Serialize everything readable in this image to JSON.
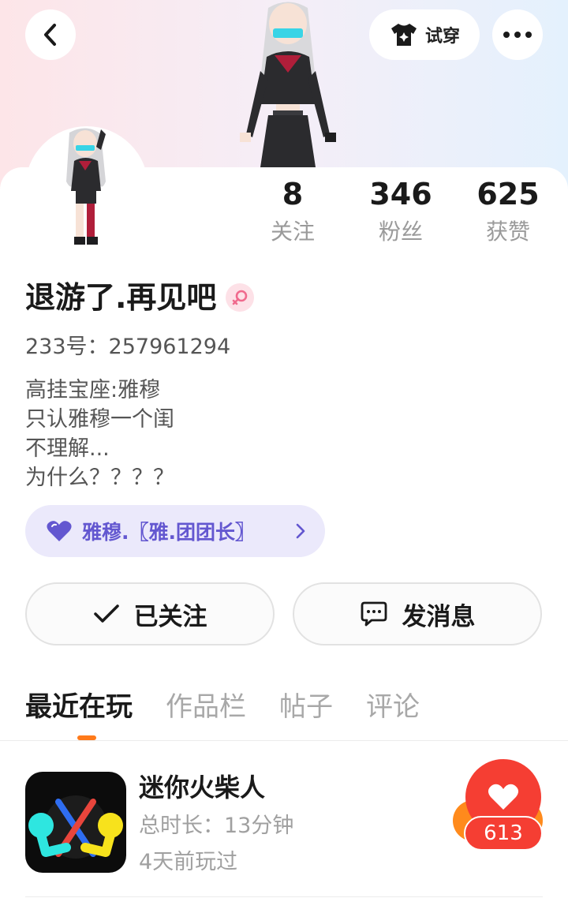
{
  "header": {
    "try_on_label": "试穿"
  },
  "stats": [
    {
      "value": "8",
      "label": "关注"
    },
    {
      "value": "346",
      "label": "粉丝"
    },
    {
      "value": "625",
      "label": "获赞"
    }
  ],
  "profile": {
    "username": "退游了.再见吧",
    "user_id": "233号：257961294",
    "bio_lines": [
      "高挂宝座:雅穆",
      "只认雅穆一个闺",
      "不理解...",
      "为什么？？？？"
    ],
    "guild_tag": "雅穆.〖雅.团团长〗"
  },
  "actions": {
    "follow_label": "已关注",
    "message_label": "发消息"
  },
  "tabs": [
    {
      "label": "最近在玩",
      "active": true
    },
    {
      "label": "作品栏",
      "active": false
    },
    {
      "label": "帖子",
      "active": false
    },
    {
      "label": "评论",
      "active": false
    }
  ],
  "recent_games": [
    {
      "title": "迷你火柴人",
      "play_time": "总时长：13分钟",
      "last_played": "4天前玩过",
      "likes": "613"
    }
  ],
  "colors": {
    "accent_orange": "#ff7a1a",
    "like_red": "#f53e33",
    "guild_purple": "#6357d0",
    "guild_bg": "#ebe9fb",
    "gender_pink": "#f06a8d"
  },
  "icons": {
    "back": "chevron-left-icon",
    "try_on": "tshirt-sparkle-icon",
    "more": "more-dots-icon",
    "gender": "female-symbol-icon",
    "guild": "heart-icon",
    "follow": "check-icon",
    "message": "chat-bubble-icon",
    "like": "heart-icon"
  }
}
